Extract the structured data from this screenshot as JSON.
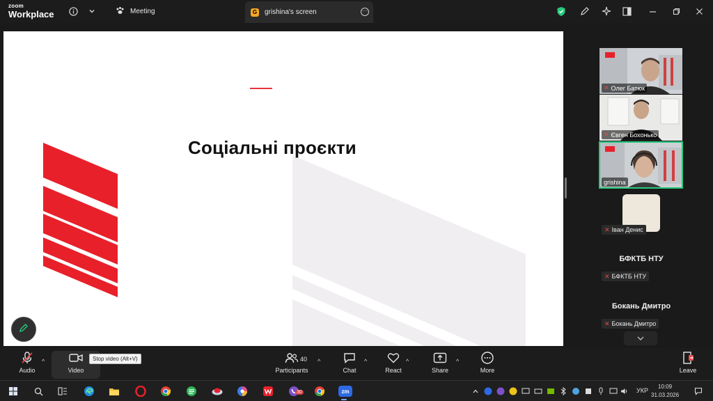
{
  "app": {
    "logo_line1": "zoom",
    "logo_line2": "Workplace"
  },
  "tabs": {
    "meeting": {
      "label": "Meeting"
    },
    "screen": {
      "label": "grishina's screen",
      "badge": "G"
    }
  },
  "slide": {
    "title": "Соціальні проєкти"
  },
  "participants_panel": {
    "tiles": [
      {
        "name": "Олег Батюк"
      },
      {
        "name": "Євген Бохонько"
      },
      {
        "name": "grishina"
      }
    ],
    "avatar_entries": [
      {
        "label": "Іван Денис"
      }
    ],
    "named_entries": [
      {
        "big": "БФКТБ НТУ",
        "label": "БФКТБ НТУ"
      },
      {
        "big": "Бокань Дмитро",
        "label": "Бокань Дмитро"
      }
    ]
  },
  "controls": {
    "audio": "Audio",
    "video": "Video",
    "video_tooltip": "Stop video (Alt+V)",
    "participants": "Participants",
    "participants_count": "40",
    "chat": "Chat",
    "react": "React",
    "share": "Share",
    "more": "More",
    "leave": "Leave"
  },
  "taskbar": {
    "badge_count": "30",
    "zoom_label": "zm",
    "language": "УКР",
    "time": "10:09",
    "date": "31.03.2026"
  },
  "colors": {
    "accent_red": "#e8202a",
    "active_speaker": "#27c97c",
    "leave_red": "#e5484d"
  }
}
